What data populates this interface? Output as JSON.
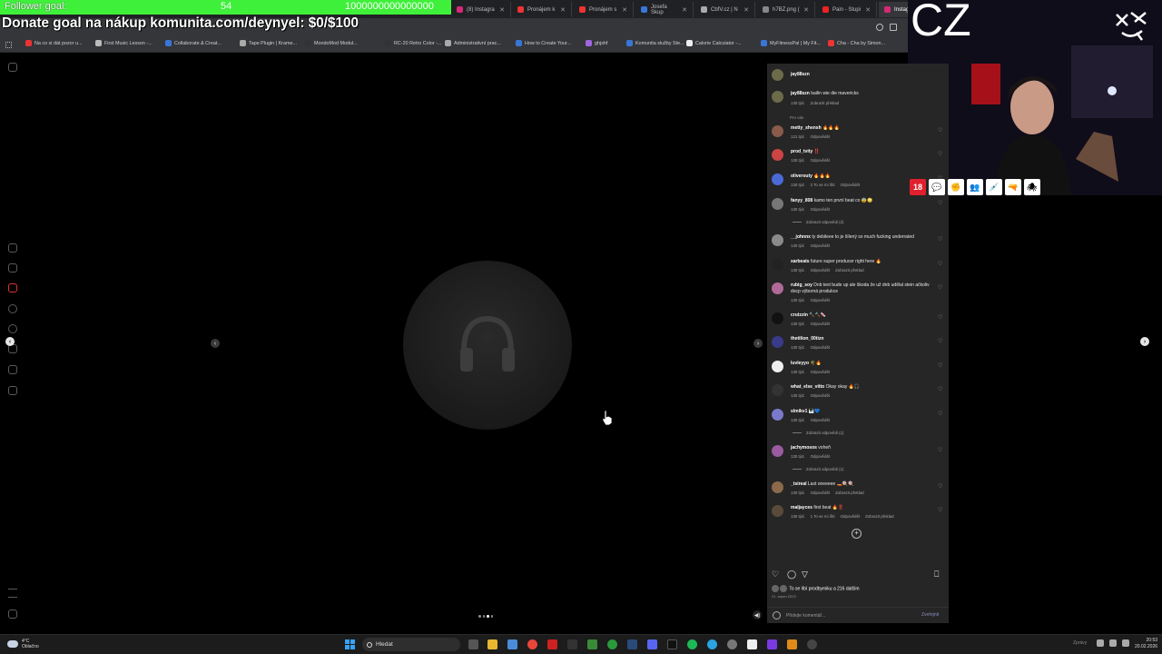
{
  "overlay": {
    "follower_goal_label": "Follower goal:",
    "follower_count": "54",
    "follower_target": "1000000000000000",
    "donate_text": "Donate goal na nákup komunita.com/deynyel: $0/$100",
    "logo_text": "CZ",
    "badge_18": "18"
  },
  "tabs": [
    {
      "label": "(8) Instagra",
      "color": "#d62976"
    },
    {
      "label": "Pronájem k",
      "color": "#e33"
    },
    {
      "label": "Pronájem s",
      "color": "#e33"
    },
    {
      "label": "Josefa Skup",
      "color": "#3a76d8"
    },
    {
      "label": "CbfV.cz | N",
      "color": "#aaa"
    },
    {
      "label": "h7BZ.png (",
      "color": "#888"
    },
    {
      "label": "Pain - Stupi",
      "color": "#e22"
    },
    {
      "label": "Instag",
      "color": "#d62976"
    }
  ],
  "bookmarks": [
    {
      "label": "Na co si dát pozor u...",
      "color": "#e33"
    },
    {
      "label": "First Music Lesson -...",
      "color": "#bbb"
    },
    {
      "label": "Collaborate & Creat...",
      "color": "#3a76d8"
    },
    {
      "label": "Tape Plugin | Krame...",
      "color": "#aaa"
    },
    {
      "label": "MondoMod Modul...",
      "color": "#333"
    },
    {
      "label": "RC-20 Retro Color -...",
      "color": "#333"
    },
    {
      "label": "Administrativní prac...",
      "color": "#aaa"
    },
    {
      "label": "How to Create Your...",
      "color": "#3a76d8"
    },
    {
      "label": "ghjshf",
      "color": "#a066e0"
    },
    {
      "label": "Komunita služby Ste...",
      "color": "#3a76d8"
    },
    {
      "label": "Calorie Calculator -...",
      "color": "#eee"
    },
    {
      "label": "MyFitnessPal | My Fit...",
      "color": "#3a76d8"
    },
    {
      "label": "Cha - Cha by Simon...",
      "color": "#e33"
    }
  ],
  "panel": {
    "header_user": "jay88szn",
    "caption_user": "jay88szn",
    "caption_text": "bailin wie die mavericks",
    "caption_meta_time": "130 týd.",
    "caption_meta_translate": "Zobrazit překlad",
    "for_you_label": "Pro vás",
    "comments": [
      {
        "user": "metty_shensh",
        "text": "🔥🔥🔥",
        "meta": [
          "121 týd.",
          "Odpovědět"
        ]
      },
      {
        "user": "prod_tvity",
        "text": "‼️",
        "meta": [
          "130 týd.",
          "Odpovědět"
        ]
      },
      {
        "user": "oliverouty",
        "text": "🔥🔥🔥",
        "meta": [
          "130 týd.",
          "2 To se mi líbí",
          "Odpovědět"
        ]
      },
      {
        "user": "fanyy_808",
        "text": "kamo ten první beat co 😨😳",
        "meta": [
          "130 týd.",
          "Odpovědět"
        ]
      },
      {
        "user": "__johnnx",
        "text": "ty debileee to je šílený so much fucking underrated",
        "meta": [
          "130 týd.",
          "Odpovědět"
        ]
      },
      {
        "user": "xarbeats",
        "text": "future super producer right here 🔥",
        "meta": [
          "130 týd.",
          "Odpovědět",
          "Zobrazit překlad"
        ]
      },
      {
        "user": "rubig_soy",
        "text": "Dnb text bude up ale škoda že už dnb udělal stein ačkoliv docp výborná produkce",
        "meta": [
          "130 týd.",
          "Odpovědět"
        ]
      },
      {
        "user": "crutzzin",
        "text": "🔨🔨🍬",
        "meta": [
          "130 týd.",
          "Odpovědět"
        ]
      },
      {
        "user": "thetilion_00tizn",
        "text": "",
        "meta": [
          "130 týd.",
          "Odpovědět"
        ]
      },
      {
        "user": "luvleyyo",
        "text": "🌴🔥",
        "meta": [
          "130 týd.",
          "Odpovědět"
        ]
      },
      {
        "user": "what_else_vitto",
        "text": "Okay okay 🔥🎧",
        "meta": [
          "130 týd.",
          "Odpovědět"
        ]
      },
      {
        "user": "slmikv1",
        "text": "🎹💙",
        "meta": [
          "130 týd.",
          "Odpovědět"
        ]
      },
      {
        "user": "jachymosos",
        "text": "voheň",
        "meta": [
          "130 týd.",
          "Odpovědět"
        ]
      },
      {
        "user": "_tsireal",
        "text": "Last oneeeee 🚤🍭🍭",
        "meta": [
          "130 týd.",
          "Odpovědět",
          "Zobrazit překlad"
        ]
      },
      {
        "user": "maljayces",
        "text": "first beat 🔥‼️",
        "meta": [
          "130 týd.",
          "1 To se mi líbí",
          "Odpovědět",
          "Zobrazit překlad"
        ]
      }
    ],
    "replies_links": [
      "Zobrazit odpovědi (2)",
      "Zobrazit odpovědi (1)",
      "Zobrazit odpovědi (1)"
    ],
    "likes_text": "To se líbí prodbymiku a 216 dalším",
    "date_text": "21. srpen 2023",
    "comment_placeholder": "Přidejte komentář...",
    "post_label": "Zveřejnit"
  },
  "taskbar": {
    "temp": "4°C",
    "weather": "Oblačno",
    "search_placeholder": "Hledat",
    "time": "20:53",
    "date": "20.02.2026",
    "tray_label": "Zprávy"
  },
  "icons": {
    "media_icon": "headphones-icon",
    "left_arrow": "chevron-left-icon",
    "right_arrow": "chevron-right-icon"
  }
}
